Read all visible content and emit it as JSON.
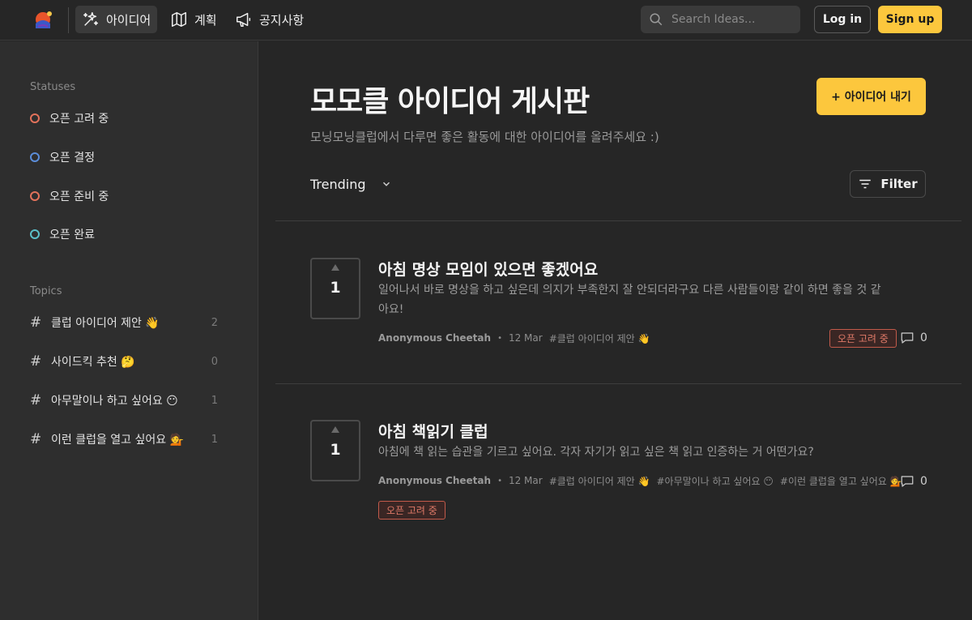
{
  "topbar": {
    "nav": [
      {
        "label": "아이디어",
        "icon": "sparkles-icon",
        "active": true
      },
      {
        "label": "계획",
        "icon": "map-icon",
        "active": false
      },
      {
        "label": "공지사항",
        "icon": "megaphone-icon",
        "active": false
      }
    ],
    "search_placeholder": "Search Ideas...",
    "login_label": "Log in",
    "signup_label": "Sign up"
  },
  "sidebar": {
    "statuses_heading": "Statuses",
    "statuses": [
      {
        "label": "오픈 고려 중",
        "color": "#e2725b"
      },
      {
        "label": "오픈 결정",
        "color": "#5b8dd9"
      },
      {
        "label": "오픈 준비 중",
        "color": "#e2725b"
      },
      {
        "label": "오픈 완료",
        "color": "#5bc0c9"
      }
    ],
    "topics_heading": "Topics",
    "topics": [
      {
        "label": "클럽 아이디어 제안 👋",
        "count": "2"
      },
      {
        "label": "사이드킥 추천 🤔",
        "count": "0"
      },
      {
        "label": "아무말이나 하고 싶어요 😶",
        "count": "1"
      },
      {
        "label": "이런 클럽을 열고 싶어요 💁",
        "count": "1"
      }
    ]
  },
  "main": {
    "title": "모모클 아이디어 게시판",
    "subtitle": "모닝모닝클럽에서 다루면 좋은 활동에 대한 아이디어를 올려주세요 :)",
    "submit_label": "+ 아이디어 내기",
    "sort_label": "Trending",
    "filter_label": "Filter",
    "ideas": [
      {
        "votes": "1",
        "title": "아침 명상 모임이 있으면 좋겠어요",
        "description": "일어나서 바로 명상을 하고 싶은데 의지가 부족한지 잘 안되더라구요 다른 사람들이랑 같이 하면 좋을 것 같아요!",
        "author": "Anonymous Cheetah",
        "date": "12 Mar",
        "tags": [
          "#클럽 아이디어 제안 👋"
        ],
        "status": "오픈 고려 중",
        "comments": "0"
      },
      {
        "votes": "1",
        "title": "아침 책읽기 클럽",
        "description": "아침에 책 읽는 습관을 기르고 싶어요. 각자 자기가 읽고 싶은 책 읽고 인증하는 거 어떤가요?",
        "author": "Anonymous Cheetah",
        "date": "12 Mar",
        "tags": [
          "#클럽 아이디어 제안 👋",
          "#아무말이나 하고 싶어요 😶",
          "#이런 클럽을 열고 싶어요 💁"
        ],
        "status": "오픈 고려 중",
        "comments": "0"
      }
    ]
  },
  "colors": {
    "accent": "#fcc73d",
    "background": "#262626",
    "sidebar": "#2e2e2e"
  }
}
